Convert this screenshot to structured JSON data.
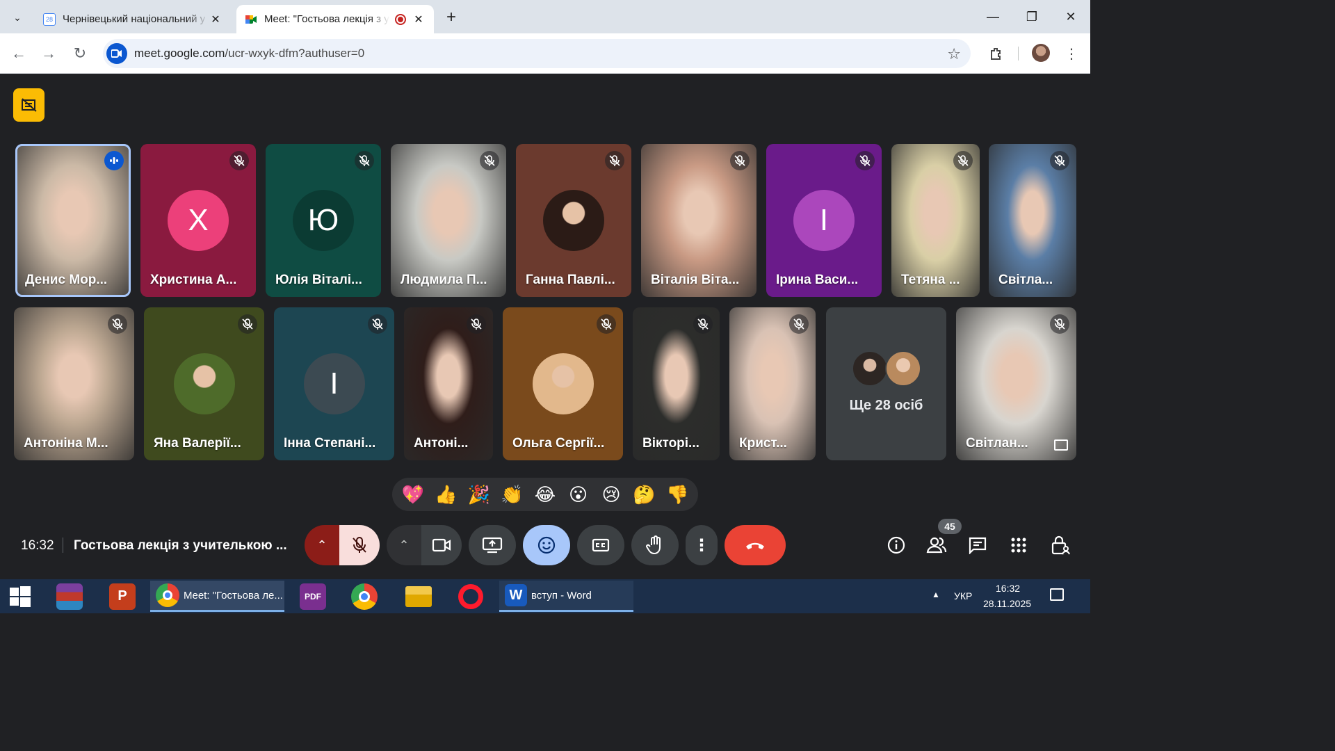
{
  "browser": {
    "tabs": [
      {
        "title": "Чернівецький національний у",
        "favicon_label": "28",
        "active": false
      },
      {
        "title": "Meet: \"Гостьова лекція з у",
        "active": true
      }
    ],
    "url_host": "meet.google.com",
    "url_path": "/ucr-wxyk-dfm?authuser=0"
  },
  "participants_row1": [
    {
      "name": "Денис Мор...",
      "type": "video",
      "bg": "#cbb9a6",
      "speaking": true
    },
    {
      "name": "Христина А...",
      "type": "initial",
      "initial": "Х",
      "bg": "#8a1a3f",
      "circle": "#ec407a"
    },
    {
      "name": "Юлія Віталі...",
      "type": "initial",
      "initial": "Ю",
      "bg": "#0f4c43",
      "circle": "#0b3b33"
    },
    {
      "name": "Людмила П...",
      "type": "video",
      "bg": "#c8c9c4"
    },
    {
      "name": "Ганна Павлі...",
      "type": "avatar",
      "bg": "#6b3a2e",
      "circle": "#2b1b16"
    },
    {
      "name": "Віталія Віта...",
      "type": "video",
      "bg": "#c99a84"
    },
    {
      "name": "Ірина Васи...",
      "type": "initial",
      "initial": "І",
      "bg": "#6a1b8a",
      "circle": "#ab47bc"
    },
    {
      "name": "Тетяна ...",
      "type": "video",
      "bg": "#d9cfa6"
    },
    {
      "name": "Світла...",
      "type": "video",
      "bg": "#5b7ea6"
    }
  ],
  "participants_row2": [
    {
      "name": "Антоніна М...",
      "type": "video",
      "bg": "#bda892"
    },
    {
      "name": "Яна Валерії...",
      "type": "avatar",
      "bg": "#3f4a1e",
      "circle": "#4e6b2a"
    },
    {
      "name": "Інна Степані...",
      "type": "initial",
      "initial": "І",
      "bg": "#1d4652",
      "circle": "#3c4a52"
    },
    {
      "name": "Антоні...",
      "type": "video",
      "bg": "#2f1d1a"
    },
    {
      "name": "Ольга Сергії...",
      "type": "avatar",
      "bg": "#7a4a1c",
      "circle": "#e2b88c"
    },
    {
      "name": "Вікторі...",
      "type": "video",
      "bg": "#2c2d2b"
    },
    {
      "name": "Крист...",
      "type": "video",
      "bg": "#d9c2b4"
    },
    {
      "name": "",
      "type": "more",
      "bg": "#3c4043"
    },
    {
      "name": "Світлан...",
      "type": "video",
      "bg": "#d8d5cf"
    }
  ],
  "more_people_label": "Ще 28 осіб",
  "reactions": [
    "💖",
    "👍",
    "🎉",
    "👏",
    "😂",
    "😮",
    "😢",
    "🤔",
    "👎"
  ],
  "meeting": {
    "time": "16:32",
    "title": "Гостьова лекція з учителькою ..."
  },
  "people_count": "45",
  "taskbar": {
    "chrome_label": "Meet: \"Гостьова ле...",
    "word_label": "вступ - Word",
    "lang": "УКР",
    "clock_time": "16:32",
    "clock_date": "28.11.2025"
  },
  "colors": {
    "meet_bg": "#202124",
    "leave_red": "#ea4335",
    "accent_blue": "#a8c7fa",
    "mic_muted": "#f9dedc"
  }
}
